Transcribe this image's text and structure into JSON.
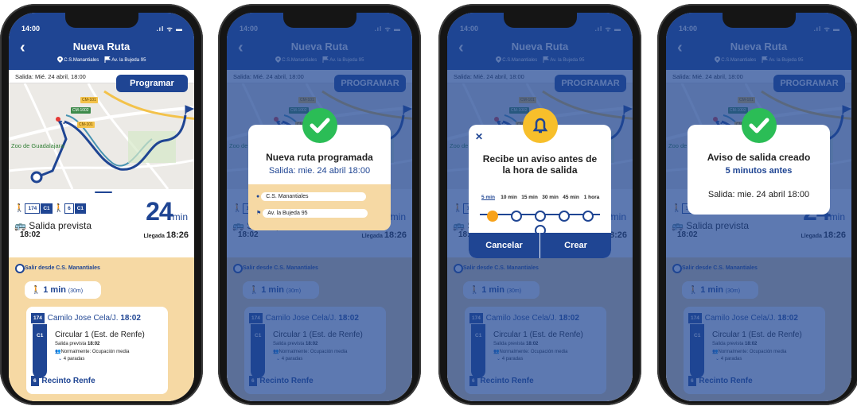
{
  "status": {
    "time": "14:00",
    "icons": ".ıl ᯤ ▬"
  },
  "header": {
    "back": "‹",
    "title": "Nueva Ruta",
    "origin": "C.S.Manantiales",
    "destination": "Av. la Bujeda 95"
  },
  "salida_bar": "Salida: Mié. 24 abril, 18:00",
  "map": {
    "road_tags": [
      "CM-101",
      "CM-1002",
      "CM-101"
    ],
    "poi": "Zoo de Guadalajara"
  },
  "summary": {
    "badges": [
      "174",
      "C1",
      "6",
      "C1"
    ],
    "walk_sub": [
      "1",
      "3"
    ],
    "minutes": "24",
    "min_unit": "min",
    "departure_label": "Salida prevista",
    "departure_time": "18:02",
    "arrival_label": "Llegada",
    "arrival_time": "18:26",
    "program_button": "Programar",
    "program_button_upper": "PROGRAMAR"
  },
  "timeline": {
    "start": "Salir desde C.S. Manantiales",
    "walk": "1 min",
    "walk_meters": "(30m)",
    "line_badge": "174",
    "stop_name": "Camilo Jose Cela/J.",
    "stop_time": "18:02",
    "route_badge": "C1",
    "route_name": "Circular 1 (Est. de Renfe)",
    "scheduled_label": "Salida prevista",
    "scheduled_time": "18:02",
    "occupancy": "Normalmente: Ocupación media",
    "stops": "4 paradas",
    "end_badge": "6",
    "end_name": "Recinto Renfe"
  },
  "modal1": {
    "title": "Nueva ruta programada",
    "subtitle": "Salida: mie. 24 abril 18:00",
    "origin": "C.S. Manantiales",
    "destination": "Av. la Bujeda 95"
  },
  "modal2": {
    "close": "✕",
    "title_line1": "Recibe un aviso antes de",
    "title_line2": "la hora de salida",
    "options": [
      "5 min",
      "10 min",
      "15 min",
      "30 min",
      "45 min",
      "1 hora"
    ],
    "selected": "5 min",
    "cancel": "Cancelar",
    "create": "Crear"
  },
  "modal3": {
    "title": "Aviso de salida creado",
    "subtitle": "5 minutos antes",
    "detail": "Salida: mie. 24 abril 18:00"
  },
  "colors": {
    "primary": "#1f4593",
    "accent": "#f7bf2b",
    "success": "#2bbd56",
    "timeline_bg": "#f6d9a4"
  }
}
